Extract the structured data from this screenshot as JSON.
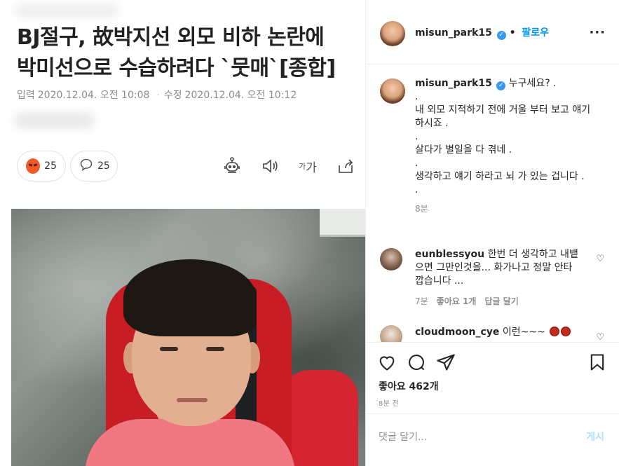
{
  "article": {
    "headline_line1": "BJ절구, 故박지선 외모 비하 논란에",
    "headline_line2": "박미선으로 수습하려다 `뭇매`[종합]",
    "meta_input_label": "입력",
    "meta_input_time": "2020.12.04. 오전 10:08",
    "meta_edit_label": "수정",
    "meta_edit_time": "2020.12.04. 오전 10:12",
    "reaction_count": "25",
    "comment_count": "25",
    "font_tool_small": "가",
    "font_tool_large": "가"
  },
  "instagram": {
    "username": "misun_park15",
    "follow_label": "팔로우",
    "caption": {
      "username": "misun_park15",
      "lines": [
        "누구세요? .",
        ".",
        "내 외모 지적하기 전에 거울 부터 보고 얘기하시죠 .",
        ".",
        "살다가 별일을 다 겪네 .",
        ".",
        "생각하고 얘기 하라고 뇌 가 있는 겁니다 .",
        "."
      ],
      "time": "8분"
    },
    "comments": [
      {
        "username": "eunblessyou",
        "text": "한번 더 생각하고 내뱉으면 그만인것을... 화가나고 정말 안타깝습니다 ...",
        "time": "7분",
        "likes": "좋아요 1개",
        "reply": "답글 달기"
      },
      {
        "username": "cloudmoon_cye",
        "text": "이런~~~"
      }
    ],
    "likes_label": "좋아요 462개",
    "posted_ago": "8분 전",
    "add_comment_placeholder": "댓글 달기...",
    "post_label": "게시"
  }
}
